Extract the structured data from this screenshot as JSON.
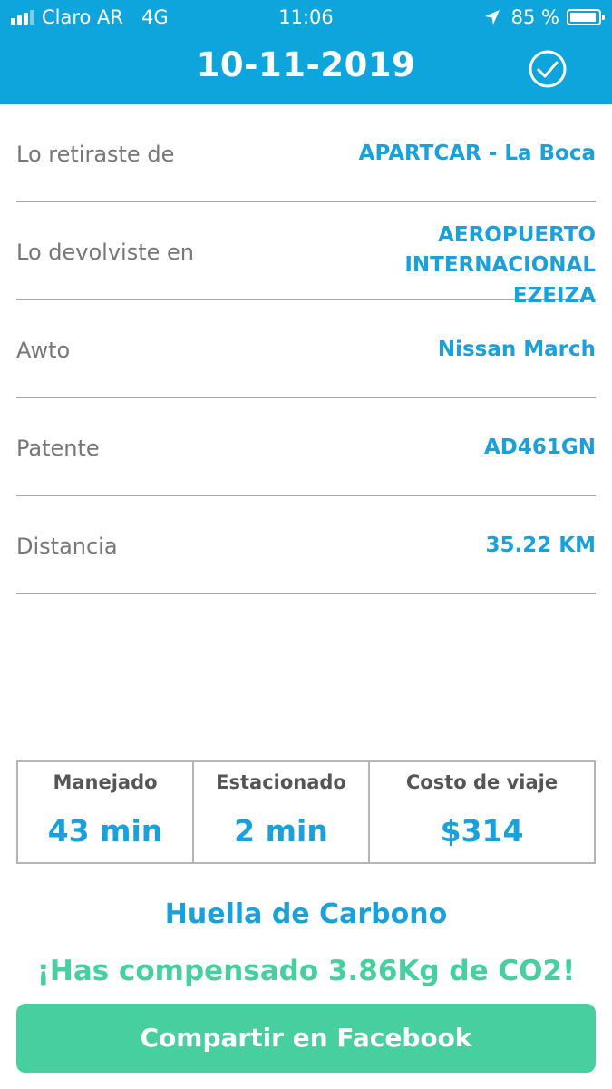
{
  "status_bar": {
    "carrier": "Claro AR",
    "network": "4G",
    "time": "11:06",
    "battery": "85 %",
    "icons": [
      "signal-icon",
      "location-arrow-icon",
      "battery-icon"
    ]
  },
  "header": {
    "title": "10-11-2019",
    "confirm_icon": "check-circle-icon",
    "background_color": "#0ea5dc"
  },
  "details": [
    {
      "label": "Lo retiraste de",
      "value": "APARTCAR - La Boca"
    },
    {
      "label": "Lo devolviste en",
      "value": "AEROPUERTO INTERNACIONAL EZEIZA"
    },
    {
      "label": "Awto",
      "value": "Nissan March"
    },
    {
      "label": "Patente",
      "value": "AD461GN"
    },
    {
      "label": "Distancia",
      "value": "35.22 KM"
    }
  ],
  "stats": [
    {
      "label": "Manejado",
      "value": "43 min"
    },
    {
      "label": "Estacionado",
      "value": "2 min"
    },
    {
      "label": "Costo de viaje",
      "value": "$314"
    }
  ],
  "carbon": {
    "title": "Huella de Carbono",
    "message": "¡Has compensado 3.86Kg de CO2!"
  },
  "share_button": {
    "label": "Compartir en Facebook",
    "color": "#48cf9f"
  },
  "colors": {
    "accent": "#1aa1db",
    "green": "#48cf9f",
    "label_gray": "#777777"
  }
}
